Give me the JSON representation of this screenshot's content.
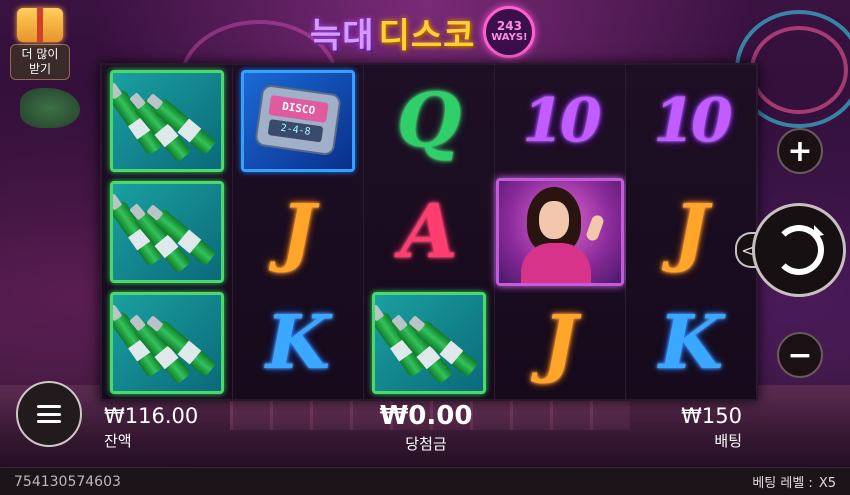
{
  "title": {
    "part1": "늑대",
    "part2": "디스코",
    "ways_number": "243",
    "ways_label": "WAYS!"
  },
  "bonus_button": {
    "label_line1": "더 많이",
    "label_line2": "받기"
  },
  "reels": [
    [
      "soju",
      "soju",
      "soju"
    ],
    [
      "pager",
      "J",
      "K"
    ],
    [
      "Q",
      "A",
      "soju"
    ],
    [
      "10",
      "diva",
      "J"
    ],
    [
      "10",
      "J",
      "K"
    ]
  ],
  "pager_text": {
    "screen1": "DISCO",
    "screen2": "2-4-8"
  },
  "controls": {
    "increase_bet": "+",
    "decrease_bet": "−",
    "spin_tab": "<"
  },
  "balance": {
    "value": "₩116.00",
    "label": "잔액"
  },
  "win": {
    "value": "₩0.00",
    "label": "당첨금"
  },
  "bet": {
    "value": "₩150",
    "label": "배팅"
  },
  "footer": {
    "round_id": "754130574603",
    "bet_level_label": "베팅 레벨 :",
    "bet_level_value": "X5"
  },
  "colors": {
    "soju_frame": "#4cd86a",
    "pager_frame": "#37a0ff",
    "diva_frame": "#c55bd8",
    "Q": "#2fd06a",
    "A": "#ff3d6e",
    "J": "#ffa62a",
    "K": "#3aa8ff",
    "10": "#c25cff"
  }
}
